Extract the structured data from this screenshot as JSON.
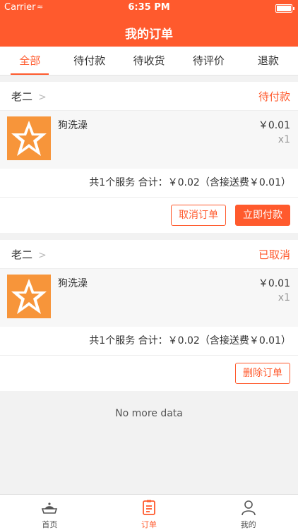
{
  "status": {
    "carrier": "Carrier",
    "time": "6:35 PM"
  },
  "nav": {
    "title": "我的订单"
  },
  "tabs": [
    {
      "label": "全部",
      "active": true
    },
    {
      "label": "待付款",
      "active": false
    },
    {
      "label": "待收货",
      "active": false
    },
    {
      "label": "待评价",
      "active": false
    },
    {
      "label": "退款",
      "active": false
    }
  ],
  "orders": [
    {
      "shop": "老二",
      "status": "待付款",
      "item": {
        "name": "狗洗澡",
        "price": "￥0.01",
        "qty": "x1"
      },
      "summary": "共1个服务 合计：￥0.02（含接送费￥0.01）",
      "actions": [
        "取消订单",
        "立即付款"
      ]
    },
    {
      "shop": "老二",
      "status": "已取消",
      "item": {
        "name": "狗洗澡",
        "price": "￥0.01",
        "qty": "x1"
      },
      "summary": "共1个服务 合计：￥0.02（含接送费￥0.01）",
      "actions": [
        "删除订单"
      ]
    }
  ],
  "footer": {
    "no_more": "No more data"
  },
  "tabbar": [
    {
      "label": "首页",
      "icon": "home-icon",
      "active": false
    },
    {
      "label": "订单",
      "icon": "order-icon",
      "active": true
    },
    {
      "label": "我的",
      "icon": "profile-icon",
      "active": false
    }
  ],
  "colors": {
    "accent": "#ff5a2d",
    "background": "#f2f2f2"
  }
}
